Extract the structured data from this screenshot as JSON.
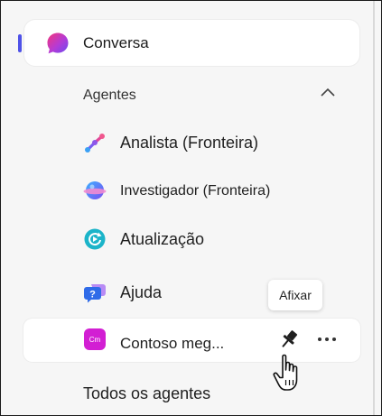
{
  "nav": {
    "main_label": "Conversa",
    "section_label": "Agentes",
    "agents": [
      {
        "label": "Analista (Fronteira)",
        "icon": "analyst-icon"
      },
      {
        "label": "Investigador (Fronteira)",
        "icon": "researcher-icon"
      },
      {
        "label": "Atualização",
        "icon": "update-icon"
      },
      {
        "label": "Ajuda",
        "icon": "help-icon"
      },
      {
        "label": "Contoso meg...",
        "icon": "contoso-icon",
        "icon_text": "Cm"
      }
    ],
    "all_agents_label": "Todos os agentes"
  },
  "tooltip": {
    "text": "Afixar"
  },
  "colors": {
    "accent": "#4f52e8",
    "panel_bg": "#f6f6f6",
    "contoso_icon_bg": "#d21fd3"
  }
}
